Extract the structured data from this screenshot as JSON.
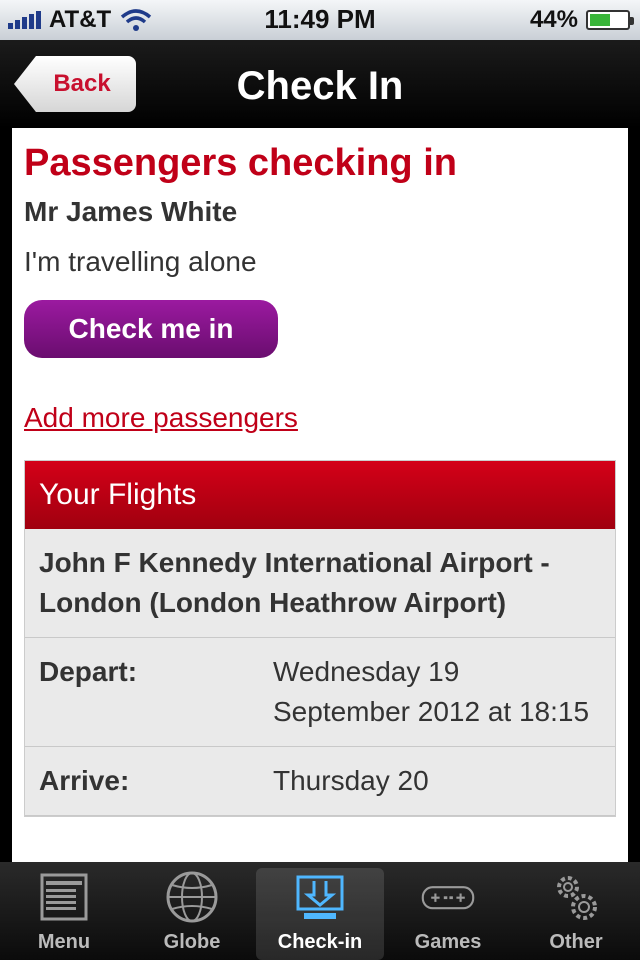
{
  "status_bar": {
    "carrier": "AT&T",
    "time": "11:49 PM",
    "battery": "44%",
    "battery_level": 0.44
  },
  "nav": {
    "back_label": "Back",
    "title": "Check In"
  },
  "checkin": {
    "heading": "Passengers checking in",
    "passenger_name": "Mr James White",
    "travel_note": "I'm travelling alone",
    "checkin_button": "Check me in",
    "add_more_link": "Add more passengers"
  },
  "flights": {
    "header": "Your Flights",
    "route": "John F Kennedy International Airport - London (London Heathrow Airport)",
    "rows": [
      {
        "label": "Depart:",
        "value": "Wednesday 19 September 2012 at 18:15"
      },
      {
        "label": "Arrive:",
        "value": "Thursday 20"
      }
    ]
  },
  "tab_bar": {
    "tabs": [
      {
        "label": "Menu",
        "icon": "menu-icon"
      },
      {
        "label": "Globe",
        "icon": "globe-icon"
      },
      {
        "label": "Check-in",
        "icon": "check-in-icon",
        "active": true
      },
      {
        "label": "Games",
        "icon": "gamepad-icon"
      },
      {
        "label": "Other",
        "icon": "gears-icon"
      }
    ]
  }
}
